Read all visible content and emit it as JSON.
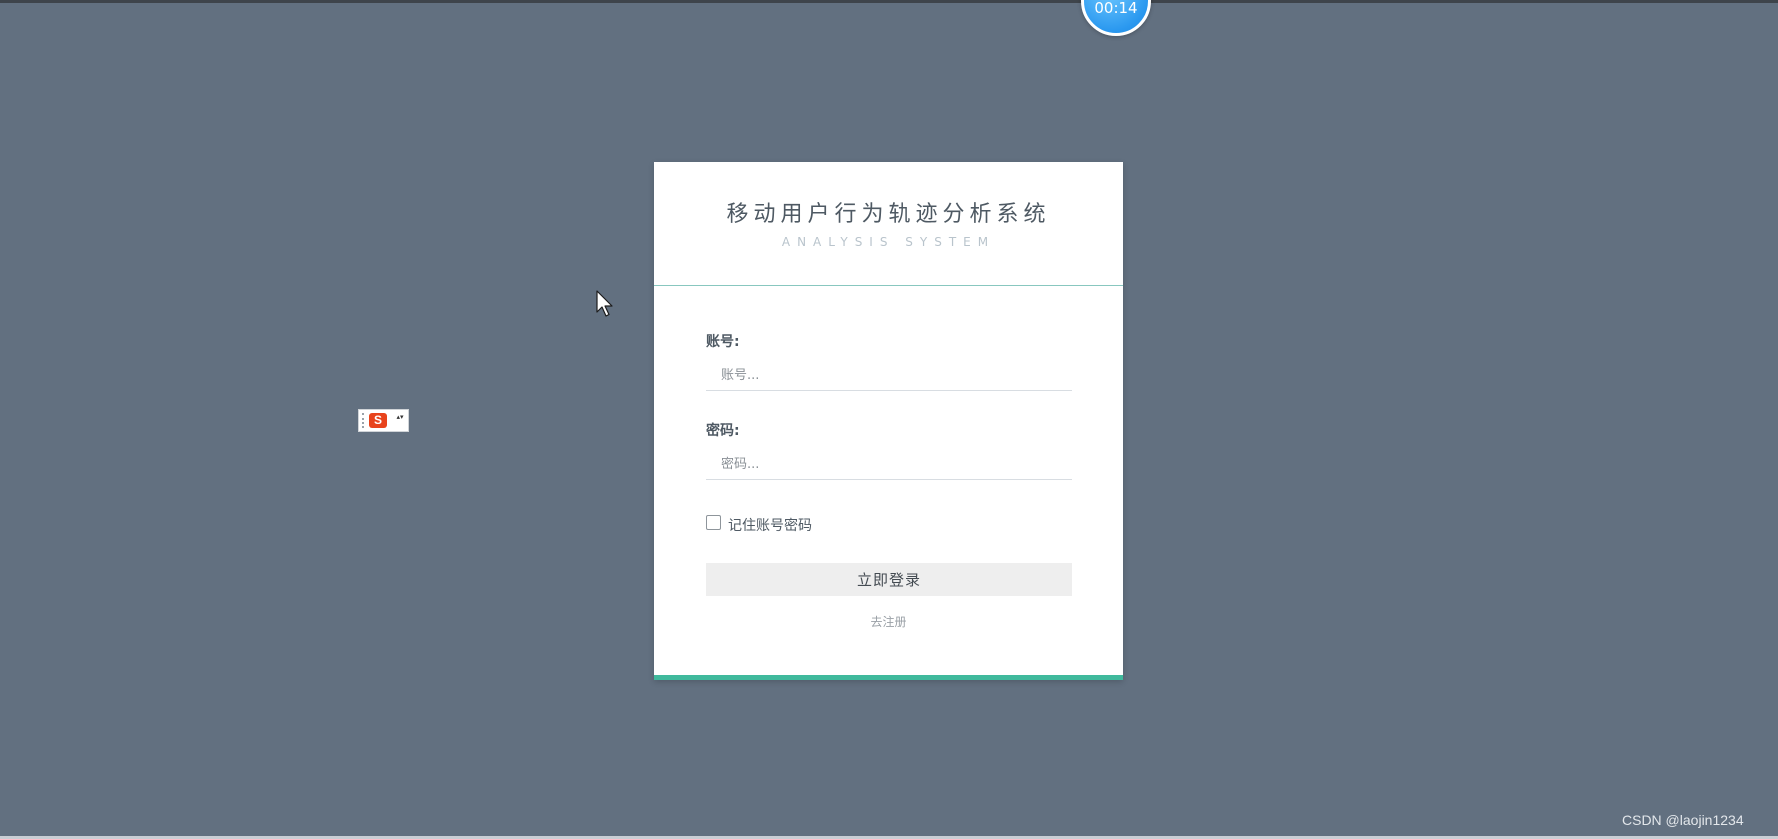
{
  "timer": {
    "text": "00:14"
  },
  "ime_toolbar": {
    "logo": "S",
    "arrows": "▴▾"
  },
  "login": {
    "title": "移动用户行为轨迹分析系统",
    "subtitle": "ANALYSIS SYSTEM",
    "account_label": "账号:",
    "account_placeholder": "账号...",
    "account_value": "",
    "password_label": "密码:",
    "password_placeholder": "密码...",
    "password_value": "",
    "remember_label": "记住账号密码",
    "remember_checked": false,
    "login_button": "立即登录",
    "register_link": "去注册"
  },
  "watermark": "CSDN @laojin1234",
  "colors": {
    "background": "#627080",
    "card": "#ffffff",
    "accent_bar": "#3fb99c",
    "header_rule": "#88c7bf",
    "timer": "#2a98ef"
  },
  "icons": {
    "cursor": "mouse-pointer-icon",
    "ime_logo": "sogou-ime-icon",
    "checkbox": "checkbox-unchecked"
  }
}
